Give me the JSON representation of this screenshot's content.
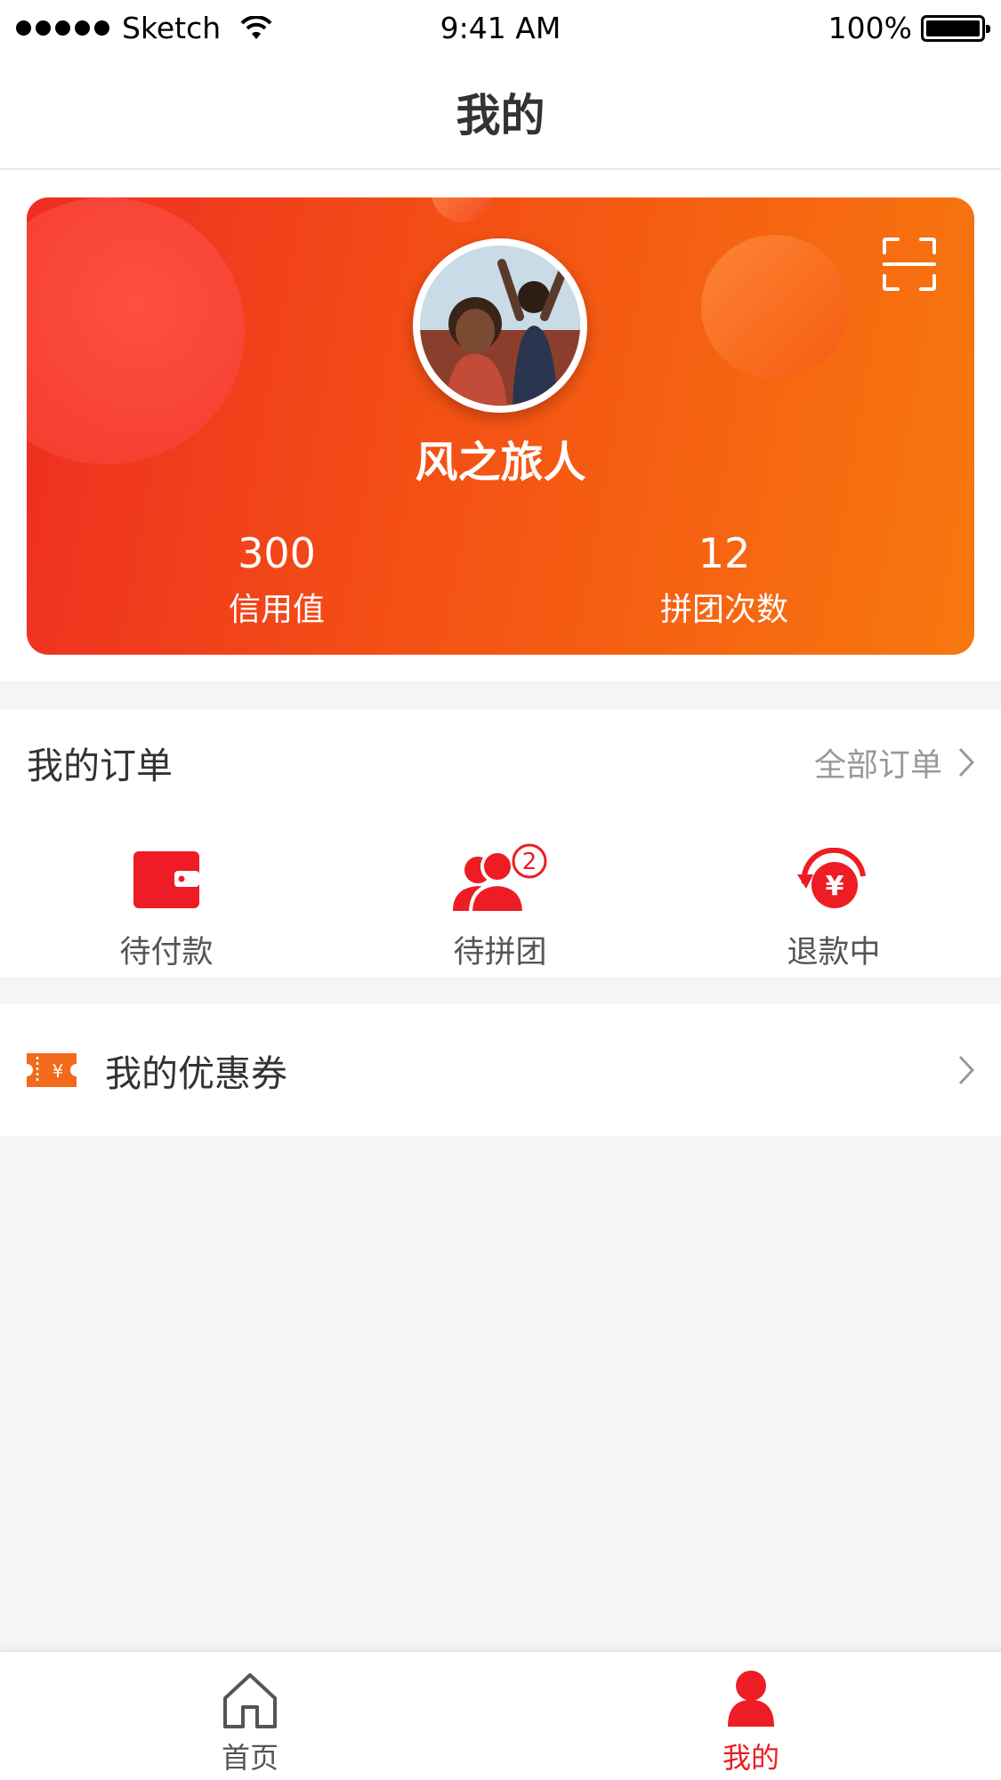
{
  "status_bar": {
    "carrier": "Sketch",
    "time": "9:41 AM",
    "battery": "100%"
  },
  "nav": {
    "title": "我的"
  },
  "profile": {
    "name": "风之旅人",
    "credit_value": "300",
    "credit_label": "信用值",
    "group_count": "12",
    "group_label": "拼团次数"
  },
  "orders": {
    "title": "我的订单",
    "all_label": "全部订单",
    "items": [
      {
        "label": "待付款",
        "icon": "wallet-icon"
      },
      {
        "label": "待拼团",
        "icon": "group-icon",
        "badge": "2"
      },
      {
        "label": "退款中",
        "icon": "refund-icon"
      }
    ]
  },
  "coupon": {
    "label": "我的优惠券",
    "icon": "coupon-icon",
    "symbol": "¥"
  },
  "tab_bar": {
    "items": [
      {
        "label": "首页",
        "icon": "home-icon"
      },
      {
        "label": "我的",
        "icon": "user-icon",
        "active": true
      }
    ]
  },
  "colors": {
    "accent": "#ee1c24",
    "gradient_start": "#ee2d22",
    "gradient_end": "#f7780f",
    "coupon": "#f26a1b"
  }
}
